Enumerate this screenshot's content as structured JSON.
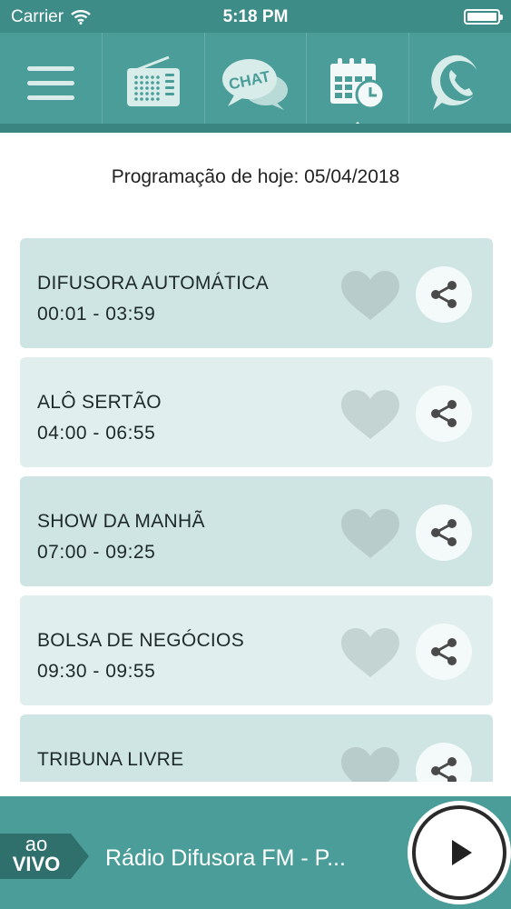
{
  "status_bar": {
    "carrier": "Carrier",
    "time": "5:18 PM"
  },
  "tabs": [
    {
      "id": "menu",
      "icon": "hamburger-menu-icon",
      "active": false
    },
    {
      "id": "radio",
      "icon": "radio-icon",
      "active": false
    },
    {
      "id": "chat",
      "icon": "chat-bubble-icon",
      "label": "CHAT",
      "active": false
    },
    {
      "id": "schedule",
      "icon": "calendar-clock-icon",
      "active": true
    },
    {
      "id": "whatsapp",
      "icon": "whatsapp-icon",
      "active": false
    }
  ],
  "page": {
    "heading": "Programação de hoje: 05/04/2018"
  },
  "programs": [
    {
      "name": "DIFUSORA AUTOMÁTICA",
      "start": "00:01",
      "end": "03:59",
      "times": "00:01 - 03:59"
    },
    {
      "name": "ALÔ SERTÃO",
      "start": "04:00",
      "end": "06:55",
      "times": "04:00 - 06:55"
    },
    {
      "name": "SHOW DA MANHÃ",
      "start": "07:00",
      "end": "09:25",
      "times": "07:00 - 09:25"
    },
    {
      "name": "BOLSA DE NEGÓCIOS",
      "start": "09:30",
      "end": "09:55",
      "times": "09:30 - 09:55"
    },
    {
      "name": "TRIBUNA LIVRE",
      "start": "",
      "end": "",
      "times": ""
    }
  ],
  "player": {
    "badge_top": "ao",
    "badge_bottom": "VIVO",
    "title": "Rádio Difusora FM - P..."
  },
  "colors": {
    "header": "#4a9d99",
    "status_bar": "#3d8c88",
    "card_dark": "#cfe5e4",
    "card_light": "#e0efee",
    "icon_gray": "#c9d3d2"
  }
}
